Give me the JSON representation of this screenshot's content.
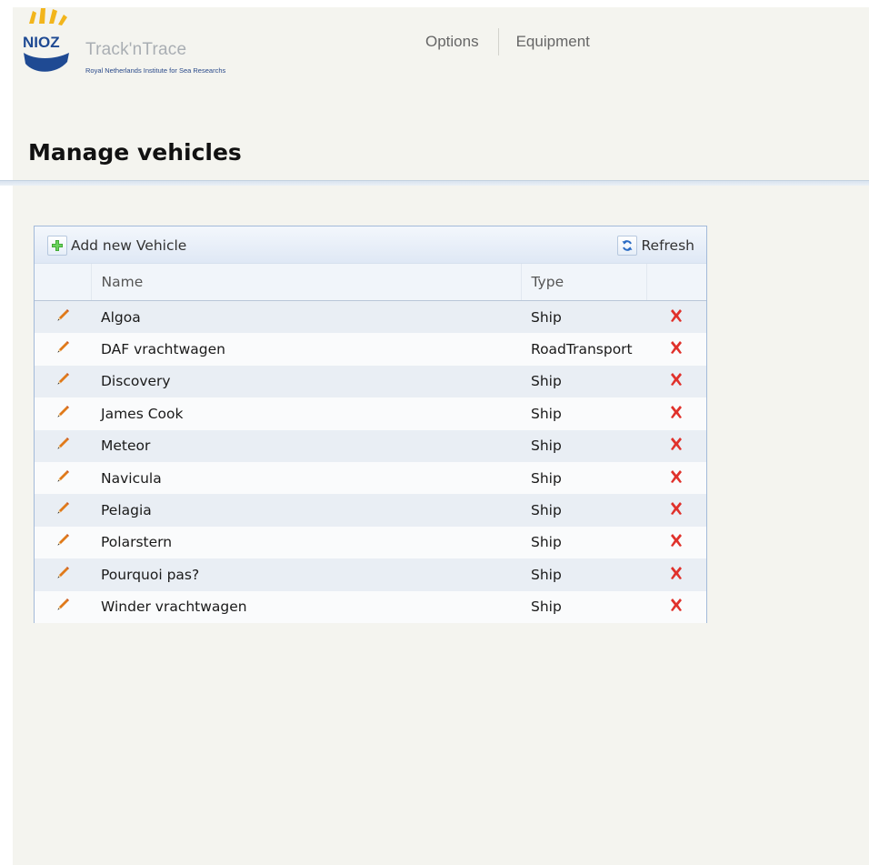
{
  "logo": {
    "brand": "NIOZ",
    "app_name": "Track'nTrace",
    "subtitle": "Royal Netherlands Institute for Sea Researchs"
  },
  "nav": {
    "options_label": "Options",
    "equipment_label": "Equipment"
  },
  "page_title": "Manage vehicles",
  "toolbar": {
    "add_label": "Add new Vehicle",
    "add_icon": "plus-icon",
    "refresh_label": "Refresh",
    "refresh_icon": "refresh-icon"
  },
  "table": {
    "columns": {
      "name": "Name",
      "type": "Type"
    },
    "edit_icon": "pencil-icon",
    "delete_icon": "delete-x-icon",
    "rows": [
      {
        "name": "Algoa",
        "type": "Ship"
      },
      {
        "name": "DAF vrachtwagen",
        "type": "RoadTransport"
      },
      {
        "name": "Discovery",
        "type": "Ship"
      },
      {
        "name": "James Cook",
        "type": "Ship"
      },
      {
        "name": "Meteor",
        "type": "Ship"
      },
      {
        "name": "Navicula",
        "type": "Ship"
      },
      {
        "name": "Pelagia",
        "type": "Ship"
      },
      {
        "name": "Polarstern",
        "type": "Ship"
      },
      {
        "name": "Pourquoi pas?",
        "type": "Ship"
      },
      {
        "name": "Winder vrachtwagen",
        "type": "Ship"
      }
    ]
  },
  "colors": {
    "brand_yellow": "#f2b51c",
    "brand_blue": "#1f4a93",
    "delete_red": "#e0312b",
    "pencil_orange": "#e07a1a"
  }
}
